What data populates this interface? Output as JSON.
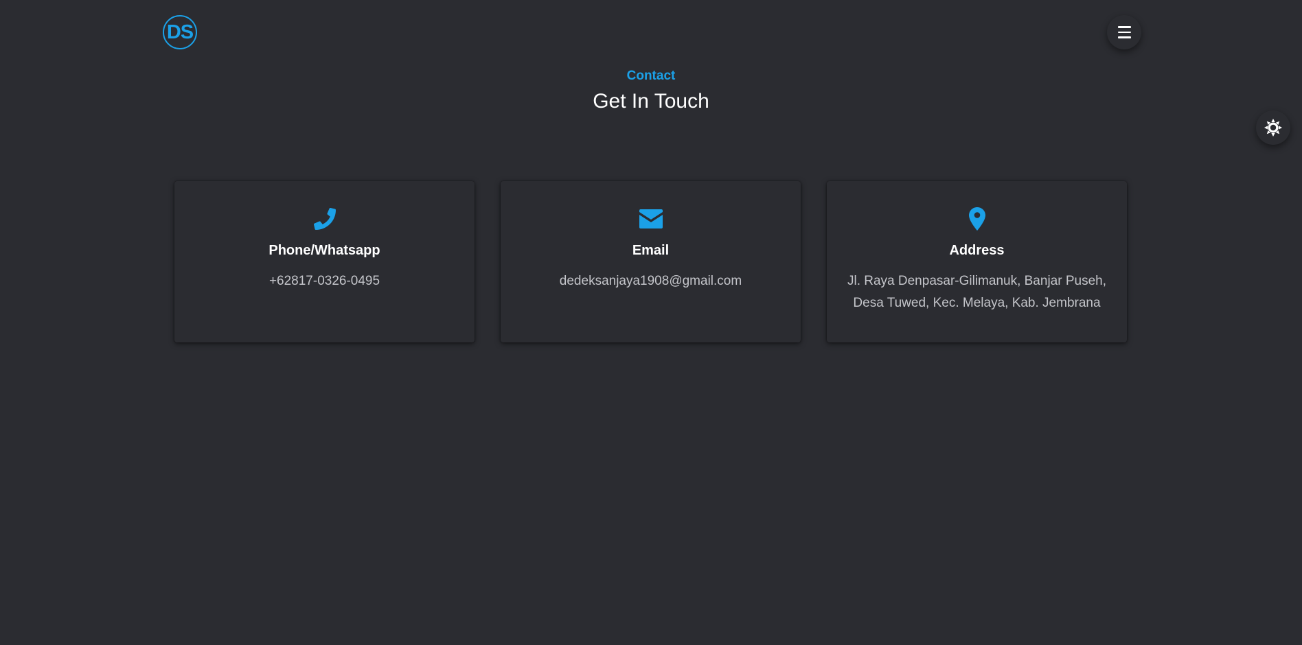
{
  "header": {
    "logo_text": "DS",
    "menu_icon": "hamburger-menu-icon",
    "theme_icon": "sun-icon"
  },
  "section": {
    "subtitle": "Contact",
    "title": "Get In Touch"
  },
  "cards": [
    {
      "icon": "phone-icon",
      "title": "Phone/Whatsapp",
      "value": "+62817-0326-0495"
    },
    {
      "icon": "envelope-icon",
      "title": "Email",
      "value": "dedeksanjaya1908@gmail.com"
    },
    {
      "icon": "map-pin-icon",
      "title": "Address",
      "value": "Jl. Raya Denpasar-Gilimanuk, Banjar Puseh, Desa Tuwed, Kec. Melaya, Kab. Jembrana"
    }
  ],
  "colors": {
    "background": "#2b2c31",
    "accent": "#1ba1e8",
    "text_primary": "#ffffff",
    "text_secondary": "#c4c5ca"
  }
}
